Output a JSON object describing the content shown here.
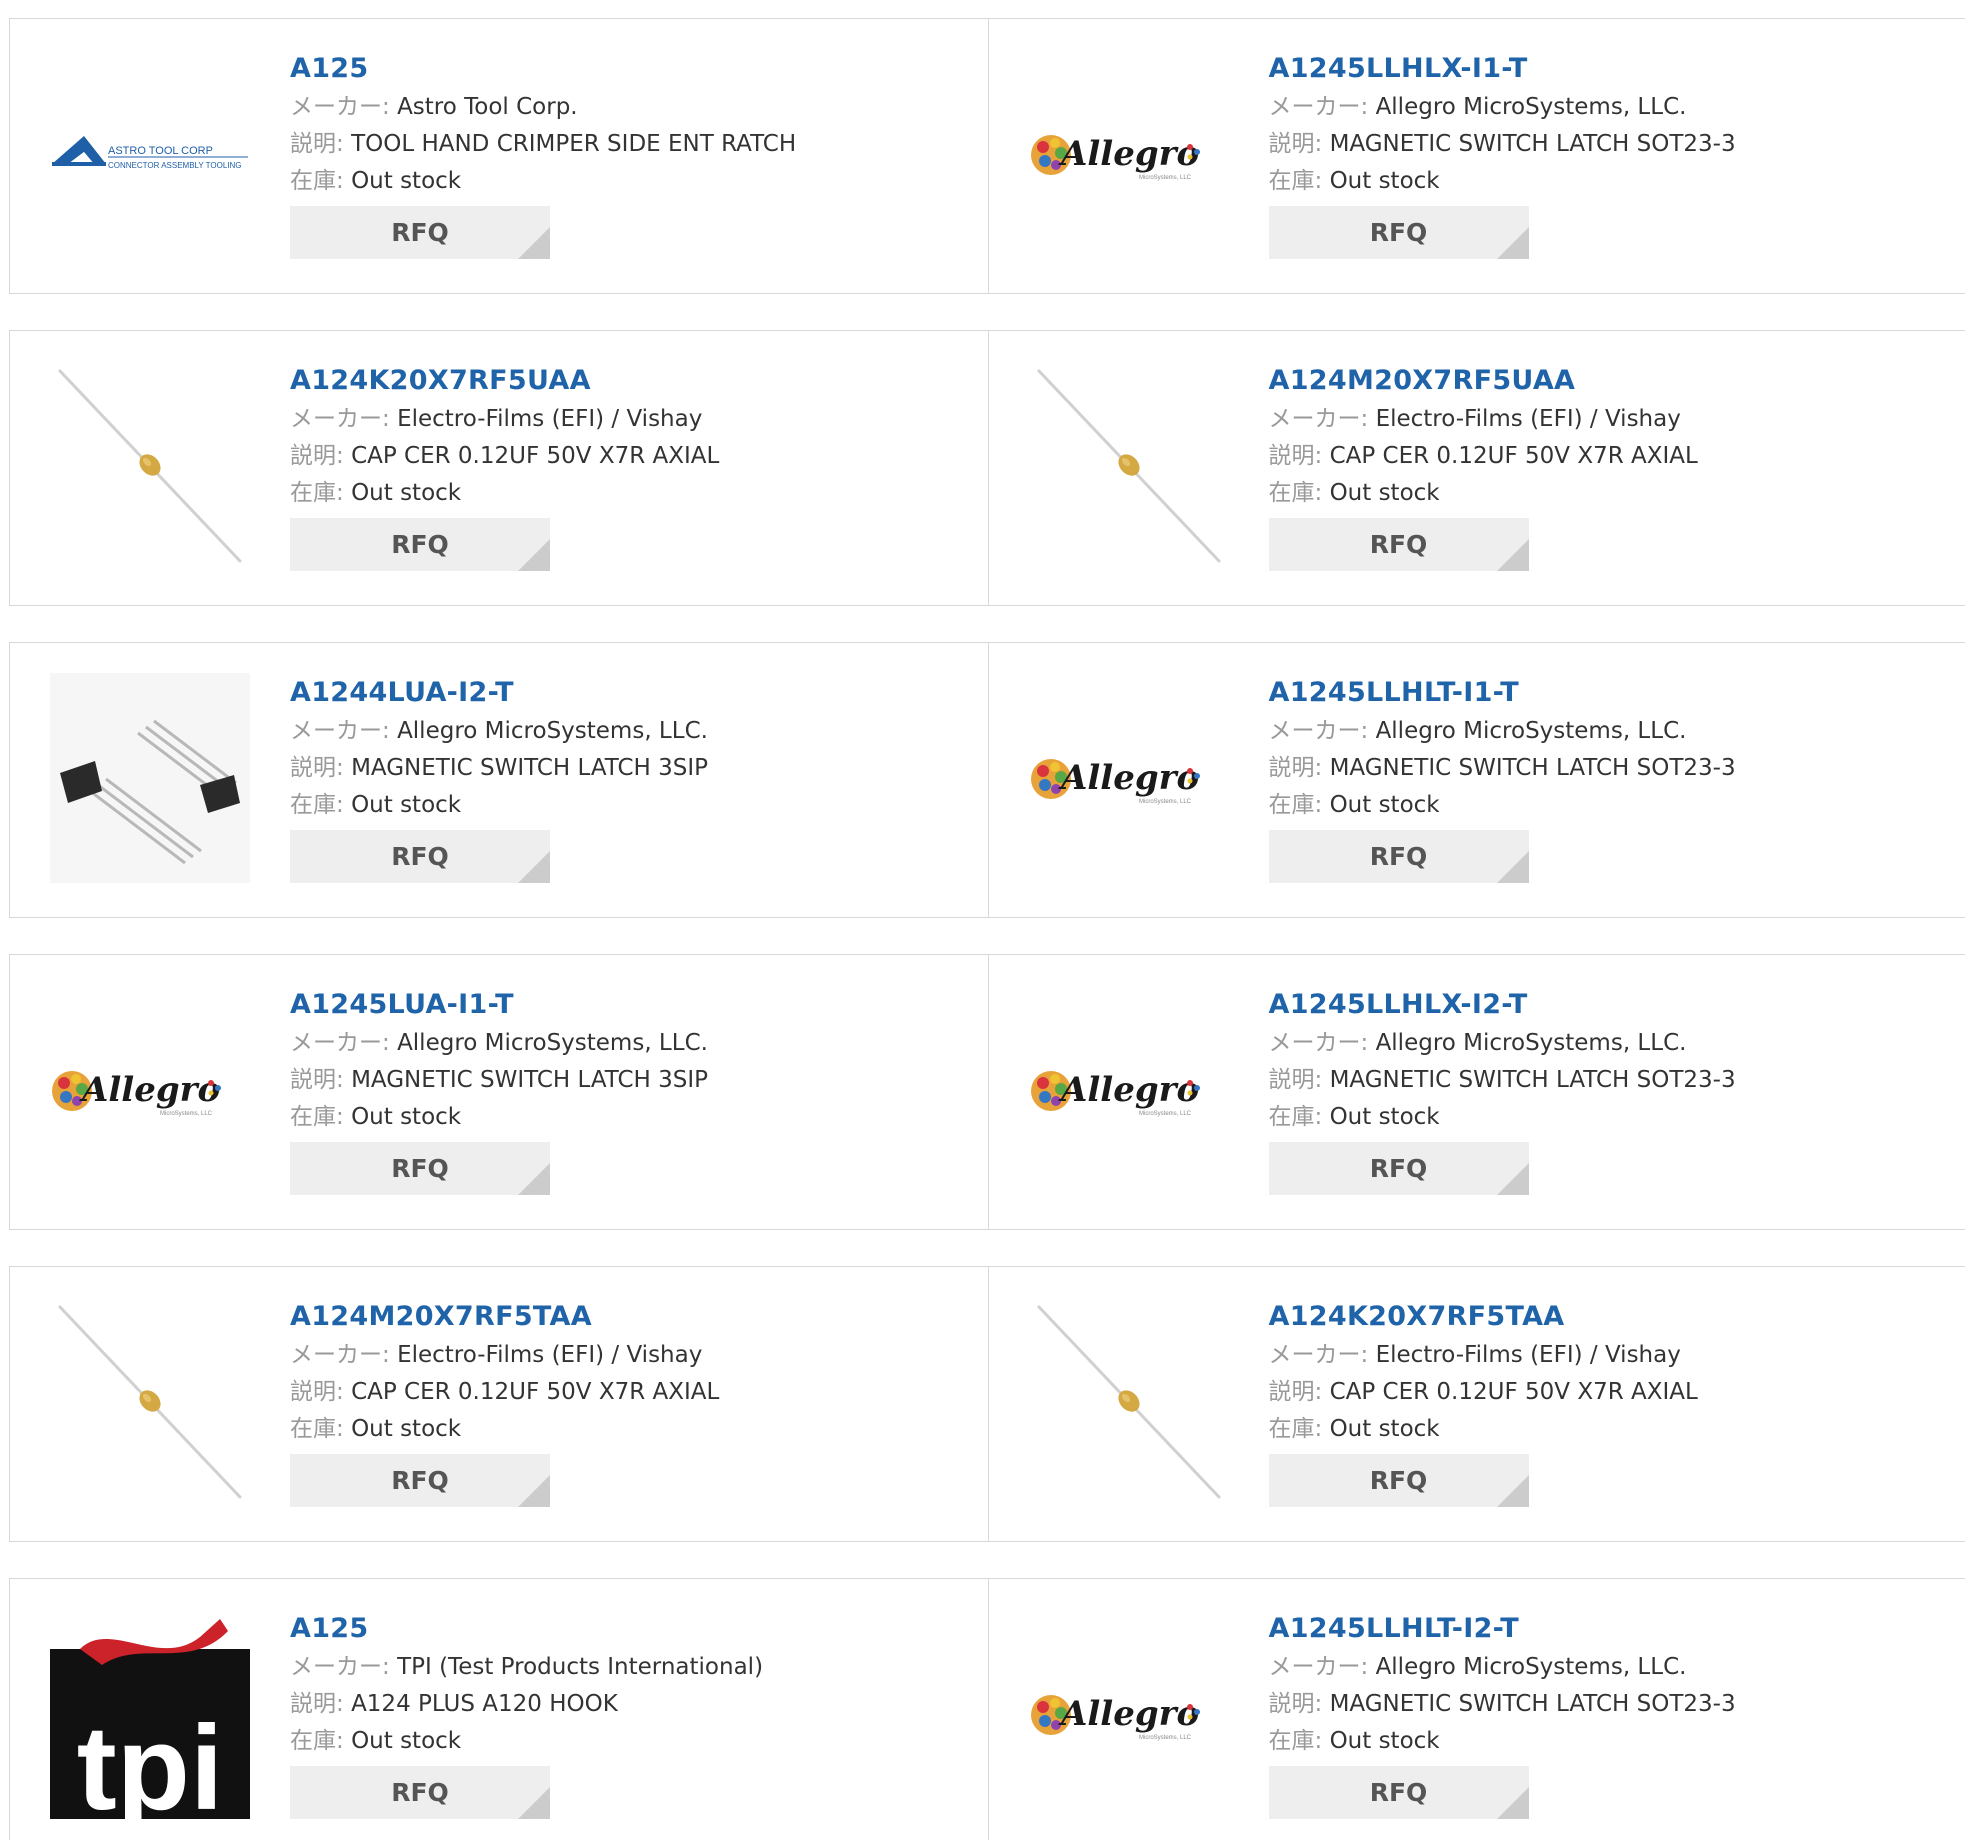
{
  "labels": {
    "maker": "メーカー:",
    "desc": "説明:",
    "stock": "在庫:"
  },
  "rfq_label": "RFQ",
  "logo_texts": {
    "astro_line1": "ASTRO TOOL CORP",
    "astro_line2": "CONNECTOR ASSEMBLY TOOLING",
    "allegro": "Allegro",
    "allegro_sub": "MicroSystems, LLC",
    "tpi": "tpi"
  },
  "colors": {
    "link": "#1f63a9",
    "label": "#999999",
    "border": "#d8d8d8",
    "rfq_bg": "#eeeeee"
  },
  "products": [
    {
      "part": "A125",
      "maker": "Astro Tool Corp.",
      "desc": "TOOL HAND CRIMPER SIDE ENT RATCH",
      "stock": "Out stock",
      "image": "astro-tool-logo"
    },
    {
      "part": "A1245LLHLX-I1-T",
      "maker": "Allegro MicroSystems, LLC.",
      "desc": "MAGNETIC SWITCH LATCH SOT23-3",
      "stock": "Out stock",
      "image": "allegro-logo"
    },
    {
      "part": "A124K20X7RF5UAA",
      "maker": "Electro-Films (EFI) / Vishay",
      "desc": "CAP CER 0.12UF 50V X7R AXIAL",
      "stock": "Out stock",
      "image": "axial-capacitor"
    },
    {
      "part": "A124M20X7RF5UAA",
      "maker": "Electro-Films (EFI) / Vishay",
      "desc": "CAP CER 0.12UF 50V X7R AXIAL",
      "stock": "Out stock",
      "image": "axial-capacitor"
    },
    {
      "part": "A1244LUA-I2-T",
      "maker": "Allegro MicroSystems, LLC.",
      "desc": "MAGNETIC SWITCH LATCH 3SIP",
      "stock": "Out stock",
      "image": "sip-package"
    },
    {
      "part": "A1245LLHLT-I1-T",
      "maker": "Allegro MicroSystems, LLC.",
      "desc": "MAGNETIC SWITCH LATCH SOT23-3",
      "stock": "Out stock",
      "image": "allegro-logo"
    },
    {
      "part": "A1245LUA-I1-T",
      "maker": "Allegro MicroSystems, LLC.",
      "desc": "MAGNETIC SWITCH LATCH 3SIP",
      "stock": "Out stock",
      "image": "allegro-logo"
    },
    {
      "part": "A1245LLHLX-I2-T",
      "maker": "Allegro MicroSystems, LLC.",
      "desc": "MAGNETIC SWITCH LATCH SOT23-3",
      "stock": "Out stock",
      "image": "allegro-logo"
    },
    {
      "part": "A124M20X7RF5TAA",
      "maker": "Electro-Films (EFI) / Vishay",
      "desc": "CAP CER 0.12UF 50V X7R AXIAL",
      "stock": "Out stock",
      "image": "axial-capacitor"
    },
    {
      "part": "A124K20X7RF5TAA",
      "maker": "Electro-Films (EFI) / Vishay",
      "desc": "CAP CER 0.12UF 50V X7R AXIAL",
      "stock": "Out stock",
      "image": "axial-capacitor"
    },
    {
      "part": "A125",
      "maker": "TPI (Test Products International)",
      "desc": "A124 PLUS A120 HOOK",
      "stock": "Out stock",
      "image": "tpi-logo"
    },
    {
      "part": "A1245LLHLT-I2-T",
      "maker": "Allegro MicroSystems, LLC.",
      "desc": "MAGNETIC SWITCH LATCH SOT23-3",
      "stock": "Out stock",
      "image": "allegro-logo"
    }
  ]
}
